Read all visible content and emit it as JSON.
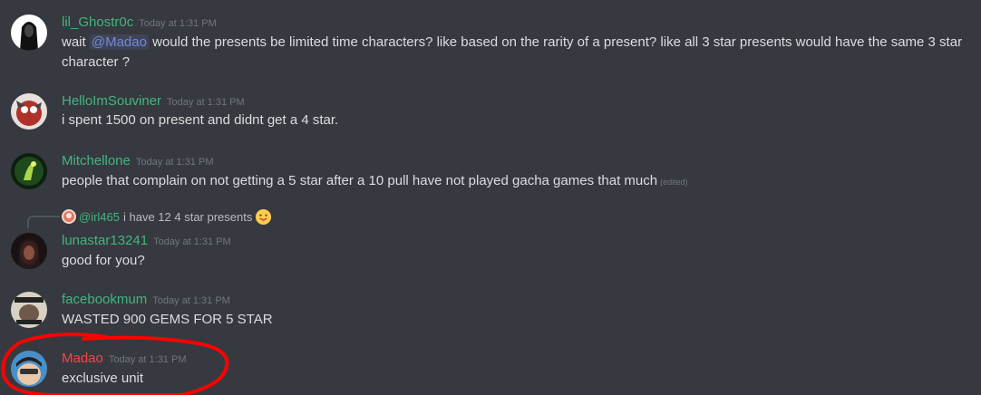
{
  "messages": [
    {
      "username": "lil_Ghostr0c",
      "timestamp": "Today at 1:31 PM",
      "text_before": "wait ",
      "mention": "@Madao",
      "text_after": " would the presents be limited time characters? like based on the rarity of a present? like all 3 star presents would have the same 3 star character ?"
    },
    {
      "username": "HelloImSouviner",
      "timestamp": "Today at 1:31 PM",
      "text": "i spent 1500 on present and didnt get a 4 star."
    },
    {
      "username": "Mitchellone",
      "timestamp": "Today at 1:31 PM",
      "text": "people that complain on not getting a 5 star after a 10 pull have not played gacha games that much",
      "edited": "(edited)"
    },
    {
      "reply": {
        "user": "@irl465",
        "text": "i have 12 4 star presents"
      },
      "username": "lunastar13241",
      "timestamp": "Today at 1:31 PM",
      "text": "good for you?"
    },
    {
      "username": "facebookmum",
      "timestamp": "Today at 1:31 PM",
      "text": "WASTED 900 GEMS FOR 5 STAR"
    },
    {
      "username": "Madao",
      "timestamp": "Today at 1:31 PM",
      "text": "exclusive unit"
    }
  ],
  "colors": {
    "background": "#36393f",
    "username_green": "#43b581",
    "username_red": "#f04747",
    "mention": "#7289da",
    "annotation_circle": "#ff0000"
  },
  "icons": {
    "reply_emoji": "tongue-out-emoji"
  }
}
